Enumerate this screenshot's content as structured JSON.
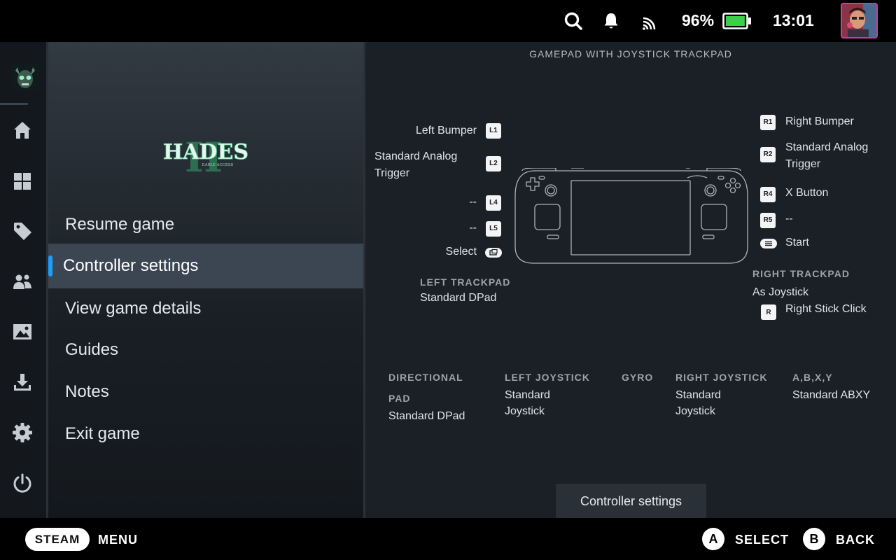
{
  "topbar": {
    "battery_percent": "96%",
    "battery_level": 0.96,
    "time": "13:01",
    "icons": [
      "search-icon",
      "bell-icon",
      "cast-icon",
      "battery-icon",
      "avatar"
    ]
  },
  "rail": {
    "items": [
      "game-icon",
      "home-icon",
      "grid-icon",
      "tag-icon",
      "friends-icon",
      "media-icon",
      "download-icon",
      "gear-icon",
      "power-icon"
    ]
  },
  "game": {
    "logo_title": "HADES",
    "logo_sub": "EARLY ACCESS"
  },
  "menu": {
    "items": [
      {
        "label": "Resume game"
      },
      {
        "label": "Controller settings",
        "active": true
      },
      {
        "label": "View game details"
      },
      {
        "label": "Guides"
      },
      {
        "label": "Notes"
      },
      {
        "label": "Exit game"
      }
    ]
  },
  "panel": {
    "heading": "GAMEPAD WITH JOYSTICK TRACKPAD",
    "left": {
      "l1": {
        "badge": "L1",
        "label": "Left Bumper"
      },
      "l2": {
        "badge": "L2",
        "label_line1": "Standard Analog",
        "label_line2": "Trigger"
      },
      "l4": {
        "badge": "L4",
        "label": "--"
      },
      "l5": {
        "badge": "L5",
        "label": "--"
      },
      "select": {
        "label": "Select"
      },
      "trackpad": {
        "header": "LEFT TRACKPAD",
        "value": "Standard DPad"
      }
    },
    "right": {
      "r1": {
        "badge": "R1",
        "label": "Right Bumper"
      },
      "r2": {
        "badge": "R2",
        "label_line1": "Standard Analog",
        "label_line2": "Trigger"
      },
      "r4": {
        "badge": "R4",
        "label": "X Button"
      },
      "r5": {
        "badge": "R5",
        "label": "--"
      },
      "start": {
        "label": "Start"
      },
      "trackpad": {
        "header": "RIGHT TRACKPAD",
        "value": "As Joystick",
        "click_badge": "R",
        "click_label": "Right Stick Click"
      }
    },
    "bottom": [
      {
        "header_line1": "DIRECTIONAL",
        "header_line2": "PAD",
        "value_line1": "Standard DPad",
        "value_line2": ""
      },
      {
        "header_line1": "LEFT JOYSTICK",
        "header_line2": "",
        "value_line1": "Standard",
        "value_line2": "Joystick"
      },
      {
        "header_line1": "GYRO",
        "header_line2": "",
        "value_line1": "",
        "value_line2": ""
      },
      {
        "header_line1": "RIGHT JOYSTICK",
        "header_line2": "",
        "value_line1": "Standard",
        "value_line2": "Joystick"
      },
      {
        "header_line1": "A,B,X,Y",
        "header_line2": "",
        "value_line1": "Standard ABXY",
        "value_line2": ""
      }
    ],
    "button_label": "Controller settings"
  },
  "bottombar": {
    "steam_label": "STEAM",
    "menu_label": "MENU",
    "a_glyph": "A",
    "select_label": "SELECT",
    "b_glyph": "B",
    "back_label": "BACK"
  },
  "colors": {
    "accent": "#1a9fff",
    "battery_fill": "#3cd04a",
    "active_item_bg": "#3c4653",
    "panel_bg": "#1b2027",
    "logo_green": "#6fe0a8"
  }
}
